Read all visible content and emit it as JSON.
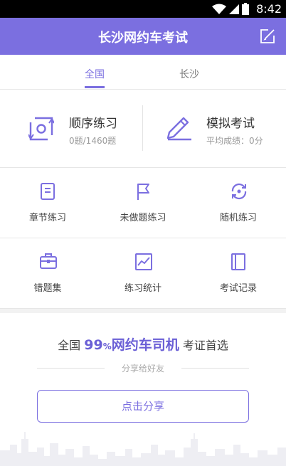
{
  "status_bar": {
    "time": "8:42",
    "icons": [
      "wifi-icon",
      "signal-icon",
      "battery-icon"
    ]
  },
  "header": {
    "title": "长沙网约车考试",
    "action_icon": "edit-icon"
  },
  "tabs": [
    {
      "label": "全国",
      "active": true
    },
    {
      "label": "长沙",
      "active": false
    }
  ],
  "practice": {
    "sequential": {
      "title": "顺序练习",
      "progress": "0题/1460题",
      "icon": "sequence-icon"
    },
    "mock_exam": {
      "title": "模拟考试",
      "score": "平均成绩：0分",
      "icon": "pencil-icon"
    }
  },
  "grid": [
    {
      "label": "章节练习",
      "icon": "document-icon"
    },
    {
      "label": "未做题练习",
      "icon": "flag-icon"
    },
    {
      "label": "随机练习",
      "icon": "random-icon"
    },
    {
      "label": "错题集",
      "icon": "briefcase-icon"
    },
    {
      "label": "练习统计",
      "icon": "chart-icon"
    },
    {
      "label": "考试记录",
      "icon": "record-icon"
    }
  ],
  "share": {
    "headline_prefix": "全国",
    "headline_number": "99",
    "headline_percent": "%",
    "headline_highlight": "网约车司机",
    "headline_suffix": "考证首选",
    "hint": "分享给好友",
    "button_label": "点击分享"
  },
  "colors": {
    "primary": "#7b6fe0",
    "accent_text": "#6a5fd6",
    "status_bar": "#000000"
  }
}
